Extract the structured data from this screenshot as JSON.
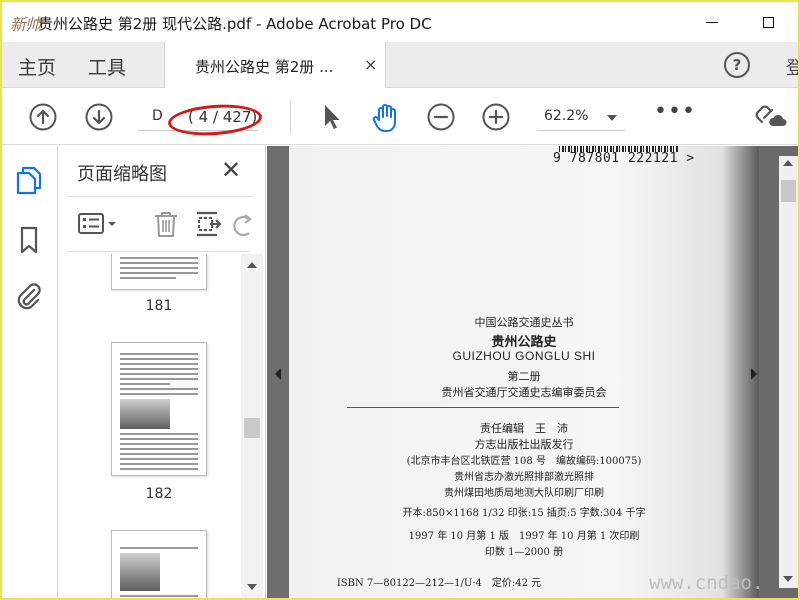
{
  "window": {
    "logo_text": "新帅",
    "title": "贵州公路史 第2册 现代公路.pdf - Adobe Acrobat Pro DC"
  },
  "tabs": {
    "home": "主页",
    "tools": "工具",
    "document": "贵州公路史 第2册 ...",
    "close_glyph": "×",
    "help_glyph": "?",
    "signin_cut": "登"
  },
  "toolbar": {
    "page_input": "D",
    "page_count": "( 4 / 427)",
    "zoom": "62.2%",
    "more": "•••"
  },
  "colors": {
    "annotation_ellipse": "#d11a1a",
    "accent_blue": "#1473e6"
  },
  "icons": {
    "prev_page": "up-arrow-circle-icon",
    "next_page": "down-arrow-circle-icon",
    "select": "arrow-cursor-icon",
    "hand": "hand-icon",
    "zoom_out": "minus-circle-icon",
    "zoom_in": "plus-circle-icon",
    "share": "link-cloud-icon"
  },
  "sidebar": {
    "panel_title": "页面缩略图",
    "close_glyph": "✕",
    "thumbnails": [
      {
        "label": "181"
      },
      {
        "label": "182"
      }
    ]
  },
  "document": {
    "barcode_number": "9 787801 222121 >",
    "series": "中国公路交通史丛书",
    "title": "贵州公路史",
    "pinyin": "GUIZHOU GONGLU SHI",
    "volume": "第二册",
    "committee": "贵州省交通厅交通史志编审委员会",
    "editor": "责任编辑　王　沛",
    "publisher": "方志出版社出版发行",
    "address": "(北京市丰台区北铁匠营 108 号　编故编码:100075)",
    "typesetting": "贵州省志办激光照排部激光照排",
    "printer": "贵州煤田地质局地测大队印刷厂印刷",
    "spec": "开本:850×1168 1/32 印张:15 插页:5 字数:304 千字",
    "edition": "1997 年 10 月第 1 版　1997 年 10 月第 1 次印刷",
    "copies": "印数 1—2000 册",
    "isbn": "ISBN 7—80122—212—1/U·4　定价:42 元"
  },
  "watermark": "www.cndao.com"
}
